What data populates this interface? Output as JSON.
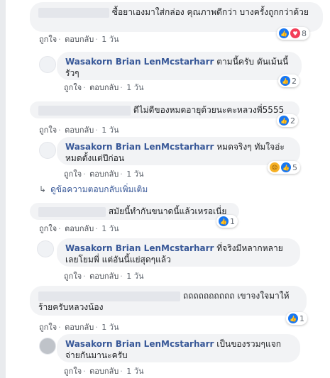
{
  "actions": {
    "like": "ถูกใจ",
    "reply": "ตอบกลับ",
    "sep": "·"
  },
  "comments": [
    {
      "name": "",
      "text": "ซื้อยาเองมาใส่กล่อง คุณภาพดีกว่า บางครั้งถูกกว่าด้วย",
      "time": "1 วัน",
      "reactions": [
        "like-icon",
        "love-icon"
      ],
      "count": "8"
    },
    {
      "name": "Wasakorn Brian LenMcstarharr",
      "text": "ตามนี้ครับ ดันเม้นนี้รัวๆ",
      "time": "1 วัน",
      "reactions": [
        "like-icon"
      ],
      "count": "2"
    },
    {
      "name": "",
      "text": "ดีไม่ดีของหมดอายุด้วยนะคะหลวงพี่5555",
      "time": "1 วัน",
      "reactions": [
        "like-icon"
      ],
      "count": "2"
    },
    {
      "name": "Wasakorn Brian LenMcstarharr",
      "text": "หมดจริงๆ ทัมใจอ่ะ หมดตั้งแต่ปีก่อน",
      "time": "1 วัน",
      "reactions": [
        "sad-icon",
        "like-icon"
      ],
      "count": "5"
    },
    {
      "name": "",
      "text": "สมัยนี้ทำกันขนาดนี้แล้วเหรอเนี่ย",
      "time": "1 วัน",
      "reactions": [
        "like-icon"
      ],
      "count": "1"
    },
    {
      "name": "Wasakorn Brian LenMcstarharr",
      "text": "ที่จริงมีหลากหลาย เลยโยมพี่ แต่อันนี้แย่สุดๆแล้ว",
      "time": "1 วัน",
      "reactions": [],
      "count": ""
    },
    {
      "name": "",
      "text": "ถถถถถถถถถถ เขาจงใจมาให้ร้ายครับหลวงน้อง",
      "time": "1 วัน",
      "reactions": [
        "like-icon"
      ],
      "count": "1"
    },
    {
      "name": "Wasakorn Brian LenMcstarharr",
      "text": "เป็นของรวมๆแจกจ่ายกันมานะครับ",
      "time": "1 วัน",
      "reactions": [],
      "count": ""
    }
  ],
  "more_replies": "ดูข้อความตอบกลับเพิ่มเติม",
  "more_arrow": "↳"
}
